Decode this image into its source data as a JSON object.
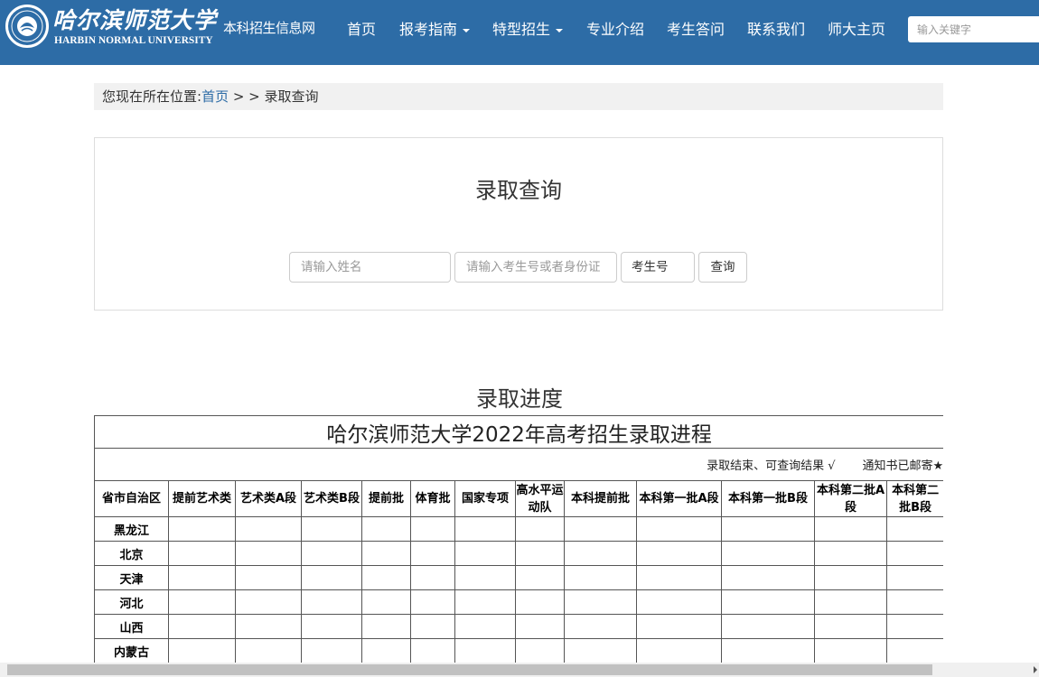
{
  "header": {
    "logo_cn": "哈尔滨师范大学",
    "logo_en": "HARBIN NORMAL UNIVERSITY",
    "site_name": "本科招生信息网",
    "colors": {
      "navbar": "#2d6ca6",
      "link": "#2d6ca6"
    },
    "nav": [
      {
        "label": "首页",
        "dropdown": false
      },
      {
        "label": "报考指南",
        "dropdown": true
      },
      {
        "label": "特型招生",
        "dropdown": true
      },
      {
        "label": "专业介绍",
        "dropdown": false
      },
      {
        "label": "考生答问",
        "dropdown": false
      },
      {
        "label": "联系我们",
        "dropdown": false
      },
      {
        "label": "师大主页",
        "dropdown": false
      }
    ],
    "search_placeholder": "输入关键字"
  },
  "breadcrumb": {
    "prefix": "您现在所在位置:",
    "home": "首页",
    "separator": " > > ",
    "current": "录取查询"
  },
  "query": {
    "title": "录取查询",
    "name_placeholder": "请输入姓名",
    "id_placeholder": "请输入考生号或者身份证",
    "id_type_selected": "考生号",
    "submit_label": "查询"
  },
  "progress": {
    "heading": "录取进度",
    "table_title": "哈尔滨师范大学2022年高考招生录取进程",
    "legend_done": "录取结束、可查询结果 √",
    "legend_mailed": "通知书已邮寄★",
    "columns": [
      "省市自治区",
      "提前艺术类",
      "艺术类A段",
      "艺术类B段",
      "提前批",
      "体育批",
      "国家专项",
      "高水平运动队",
      "本科提前批",
      "本科第一批A段",
      "本科第一批B段",
      "本科第二批A段",
      "本科第二批B段"
    ],
    "rows": [
      {
        "province": "黑龙江"
      },
      {
        "province": "北京"
      },
      {
        "province": "天津"
      },
      {
        "province": "河北"
      },
      {
        "province": "山西"
      },
      {
        "province": "内蒙古"
      }
    ]
  }
}
